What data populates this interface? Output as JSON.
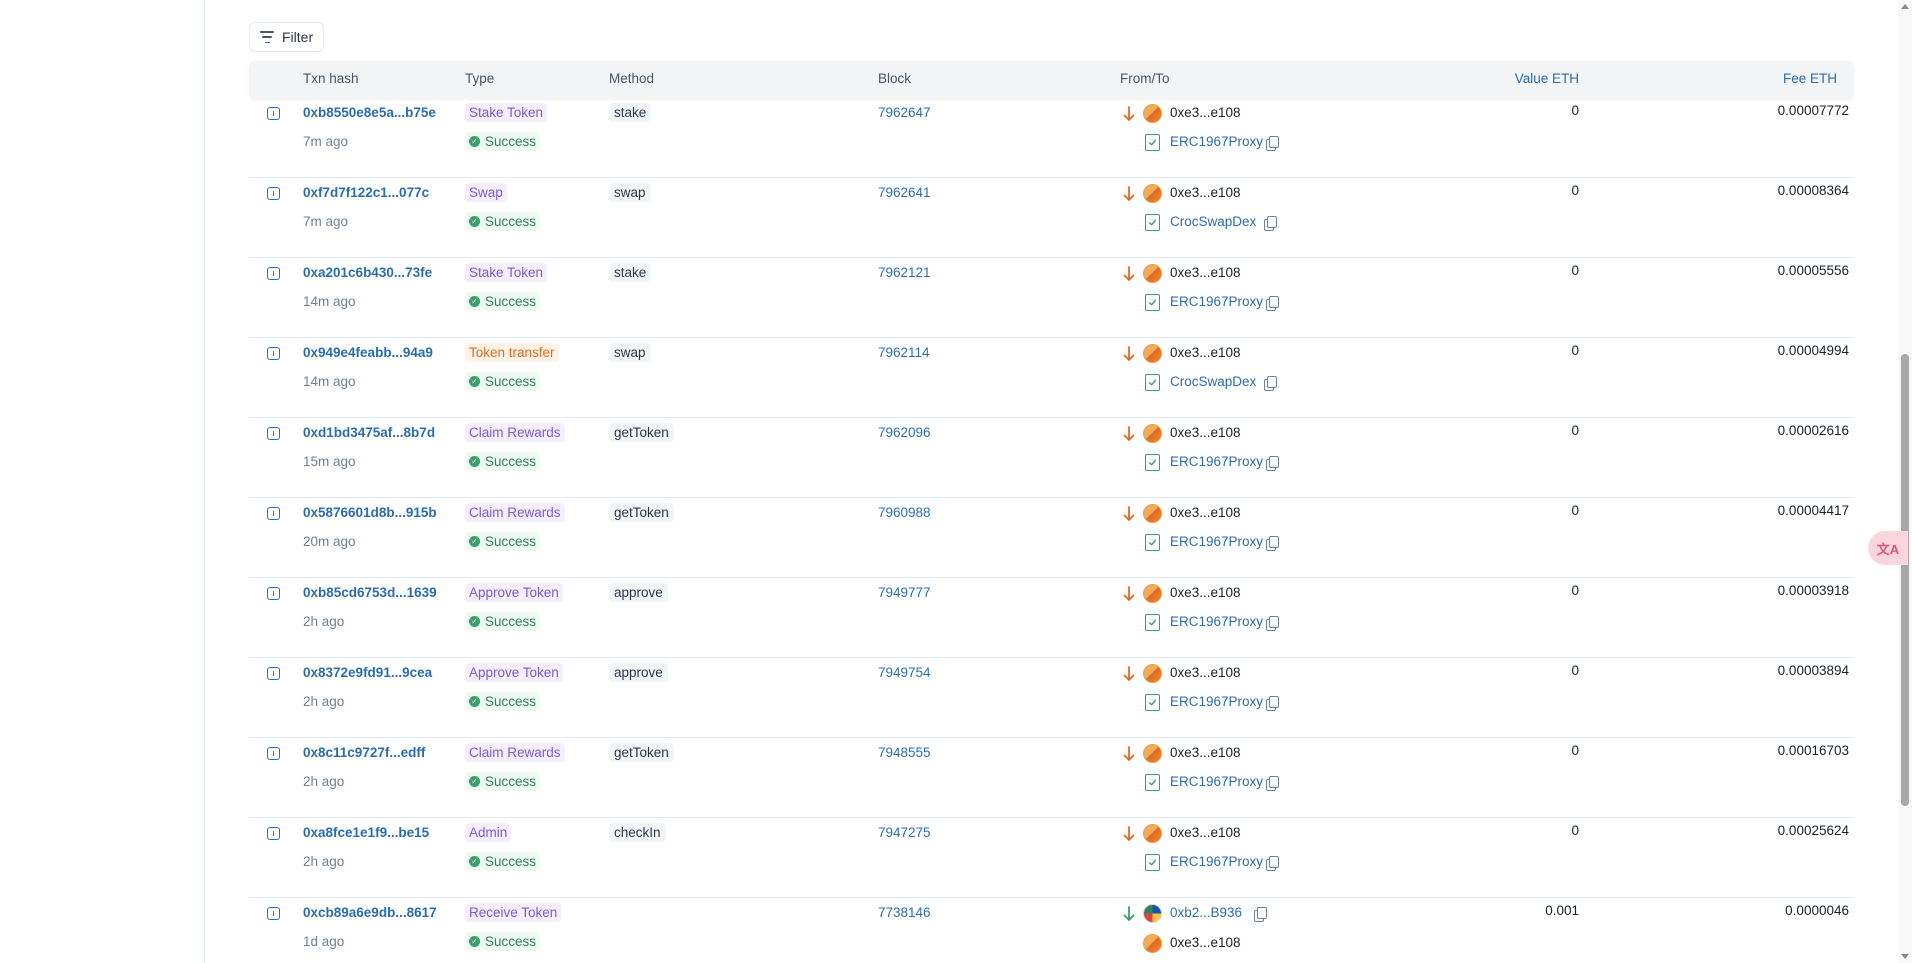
{
  "toolbar": {
    "filter_label": "Filter"
  },
  "table": {
    "headers": {
      "txn_hash": "Txn hash",
      "type": "Type",
      "method": "Method",
      "block": "Block",
      "from_to": "From/To",
      "value": "Value ETH",
      "fee": "Fee ETH"
    },
    "rows": [
      {
        "hash": "0xb8550e8e5a...b75e",
        "time": "7m ago",
        "type": "Stake Token",
        "type_color": "purple",
        "status": "Success",
        "method": "stake",
        "block": "7962647",
        "from": "0xe3...e108",
        "to": "ERC1967Proxy",
        "value": "0",
        "fee": "0.00007772"
      },
      {
        "hash": "0xf7d7f122c1...077c",
        "time": "7m ago",
        "type": "Swap",
        "type_color": "purple",
        "status": "Success",
        "method": "swap",
        "block": "7962641",
        "from": "0xe3...e108",
        "to": "CrocSwapDex",
        "value": "0",
        "fee": "0.00008364"
      },
      {
        "hash": "0xa201c6b430...73fe",
        "time": "14m ago",
        "type": "Stake Token",
        "type_color": "purple",
        "status": "Success",
        "method": "stake",
        "block": "7962121",
        "from": "0xe3...e108",
        "to": "ERC1967Proxy",
        "value": "0",
        "fee": "0.00005556"
      },
      {
        "hash": "0x949e4feabb...94a9",
        "time": "14m ago",
        "type": "Token transfer",
        "type_color": "orange",
        "status": "Success",
        "method": "swap",
        "block": "7962114",
        "from": "0xe3...e108",
        "to": "CrocSwapDex",
        "value": "0",
        "fee": "0.00004994"
      },
      {
        "hash": "0xd1bd3475af...8b7d",
        "time": "15m ago",
        "type": "Claim Rewards",
        "type_color": "purple",
        "status": "Success",
        "method": "getToken",
        "block": "7962096",
        "from": "0xe3...e108",
        "to": "ERC1967Proxy",
        "value": "0",
        "fee": "0.00002616"
      },
      {
        "hash": "0x5876601d8b...915b",
        "time": "20m ago",
        "type": "Claim Rewards",
        "type_color": "purple",
        "status": "Success",
        "method": "getToken",
        "block": "7960988",
        "from": "0xe3...e108",
        "to": "ERC1967Proxy",
        "value": "0",
        "fee": "0.00004417"
      },
      {
        "hash": "0xb85cd6753d...1639",
        "time": "2h ago",
        "type": "Approve Token",
        "type_color": "purple",
        "status": "Success",
        "method": "approve",
        "block": "7949777",
        "from": "0xe3...e108",
        "to": "ERC1967Proxy",
        "value": "0",
        "fee": "0.00003918"
      },
      {
        "hash": "0x8372e9fd91...9cea",
        "time": "2h ago",
        "type": "Approve Token",
        "type_color": "purple",
        "status": "Success",
        "method": "approve",
        "block": "7949754",
        "from": "0xe3...e108",
        "to": "ERC1967Proxy",
        "value": "0",
        "fee": "0.00003894"
      },
      {
        "hash": "0x8c11c9727f...edff",
        "time": "2h ago",
        "type": "Claim Rewards",
        "type_color": "purple",
        "status": "Success",
        "method": "getToken",
        "block": "7948555",
        "from": "0xe3...e108",
        "to": "ERC1967Proxy",
        "value": "0",
        "fee": "0.00016703"
      },
      {
        "hash": "0xa8fce1e1f9...be15",
        "time": "2h ago",
        "type": "Admin",
        "type_color": "purple",
        "status": "Success",
        "method": "checkIn",
        "block": "7947275",
        "from": "0xe3...e108",
        "to": "ERC1967Proxy",
        "value": "0",
        "fee": "0.00025624"
      },
      {
        "hash": "0xcb89a6e9db...8617",
        "time": "1d ago",
        "type": "Receive Token",
        "type_color": "purple",
        "status": "Success",
        "method": "",
        "block": "7738146",
        "from": "0xb2...B936",
        "to": "0xe3...e108",
        "value": "0.001",
        "fee": "0.0000046",
        "incoming": true
      }
    ]
  },
  "colors": {
    "link": "#2b6cb0",
    "purple_tag": "#805ad5",
    "orange_tag": "#dd6b20",
    "success": "#38a169",
    "out_arrow": "#dd6b20",
    "in_arrow": "#38a169"
  },
  "icons": {
    "filter": "filter-icon",
    "tx_details": "tx-details-icon",
    "status": "check-circle-icon",
    "direction_out": "arrow-down-orange-icon",
    "direction_in": "arrow-down-green-icon",
    "contract": "contract-verified-icon",
    "copy": "copy-icon",
    "translate": "translate-icon"
  },
  "translate_widget": {
    "label": "文A"
  }
}
